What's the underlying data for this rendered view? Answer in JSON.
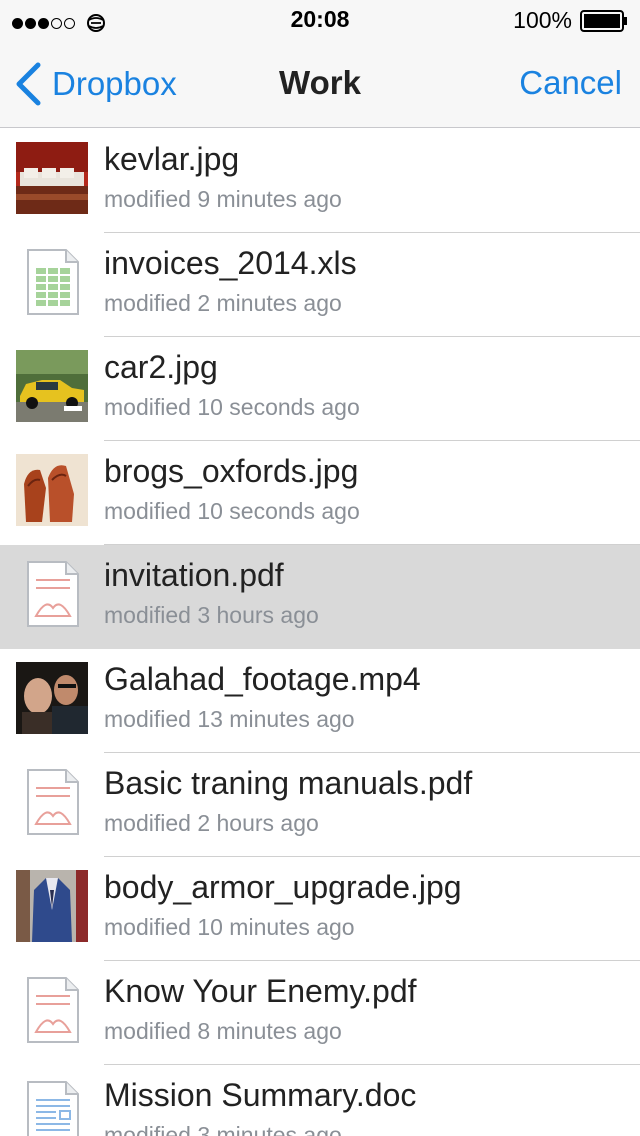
{
  "status_bar": {
    "time": "20:08",
    "battery": "100%",
    "signal_bars_filled": 3,
    "signal_bars_total": 5,
    "carrier_icon": "carrier-icon"
  },
  "nav": {
    "back_label": "Dropbox",
    "title": "Work",
    "cancel_label": "Cancel",
    "accent_color": "#1a82e0"
  },
  "files": [
    {
      "name": "kevlar.jpg",
      "meta": "modified 9 minutes ago",
      "kind": "photo-kevlar",
      "selected": false
    },
    {
      "name": "invoices_2014.xls",
      "meta": "modified 2 minutes ago",
      "kind": "spreadsheet-icon",
      "selected": false
    },
    {
      "name": "car2.jpg",
      "meta": "modified 10 seconds ago",
      "kind": "photo-car",
      "selected": false
    },
    {
      "name": "brogs_oxfords.jpg",
      "meta": "modified 10 seconds ago",
      "kind": "photo-shoes",
      "selected": false
    },
    {
      "name": "invitation.pdf",
      "meta": "modified 3 hours ago",
      "kind": "pdf-icon",
      "selected": true
    },
    {
      "name": "Galahad_footage.mp4",
      "meta": "modified 13 minutes ago",
      "kind": "video-thumb",
      "selected": false
    },
    {
      "name": "Basic traning manuals.pdf",
      "meta": "modified 2 hours ago",
      "kind": "pdf-icon",
      "selected": false
    },
    {
      "name": "body_armor_upgrade.jpg",
      "meta": "modified 10 minutes ago",
      "kind": "photo-suit",
      "selected": false
    },
    {
      "name": "Know Your Enemy.pdf",
      "meta": "modified 8 minutes ago",
      "kind": "pdf-icon",
      "selected": false
    },
    {
      "name": "Mission Summary.doc",
      "meta": "modified 3 minutes ago",
      "kind": "doc-icon",
      "selected": false
    }
  ]
}
